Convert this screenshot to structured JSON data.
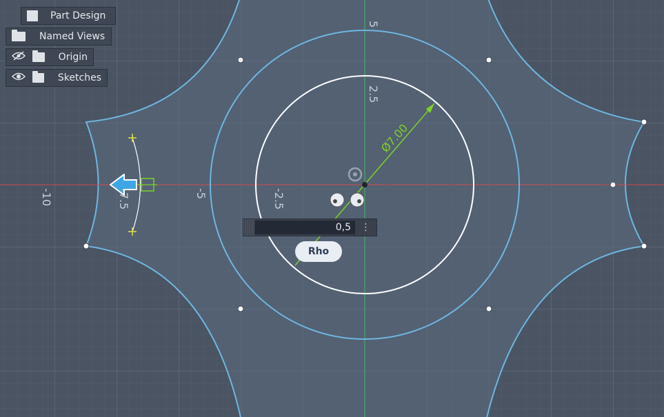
{
  "tree": {
    "part_design": "Part Design",
    "named_views": "Named Views",
    "origin": "Origin",
    "sketches": "Sketches"
  },
  "axis_labels": {
    "y_5": "5",
    "y_2_5": "2.5",
    "x_neg_10": "-10",
    "x_neg_7_5": "-7.5",
    "x_neg_5": "-5",
    "x_neg_2_5": "-2.5"
  },
  "dimension": "Ø7.00",
  "input": {
    "value": "0,5",
    "menu_icon": "vertical-dots-icon"
  },
  "tooltip": "Rho",
  "colors": {
    "background": "#4a5463",
    "grid": "#5a6473",
    "sketch_curve": "#6fb6e0",
    "circle": "#ffffff",
    "dimension": "#7ed321",
    "x_axis": "#d04a4a",
    "y_axis": "#3fbf5f",
    "arrow": "#3ea6e6",
    "constraint": "#e2e34a"
  }
}
